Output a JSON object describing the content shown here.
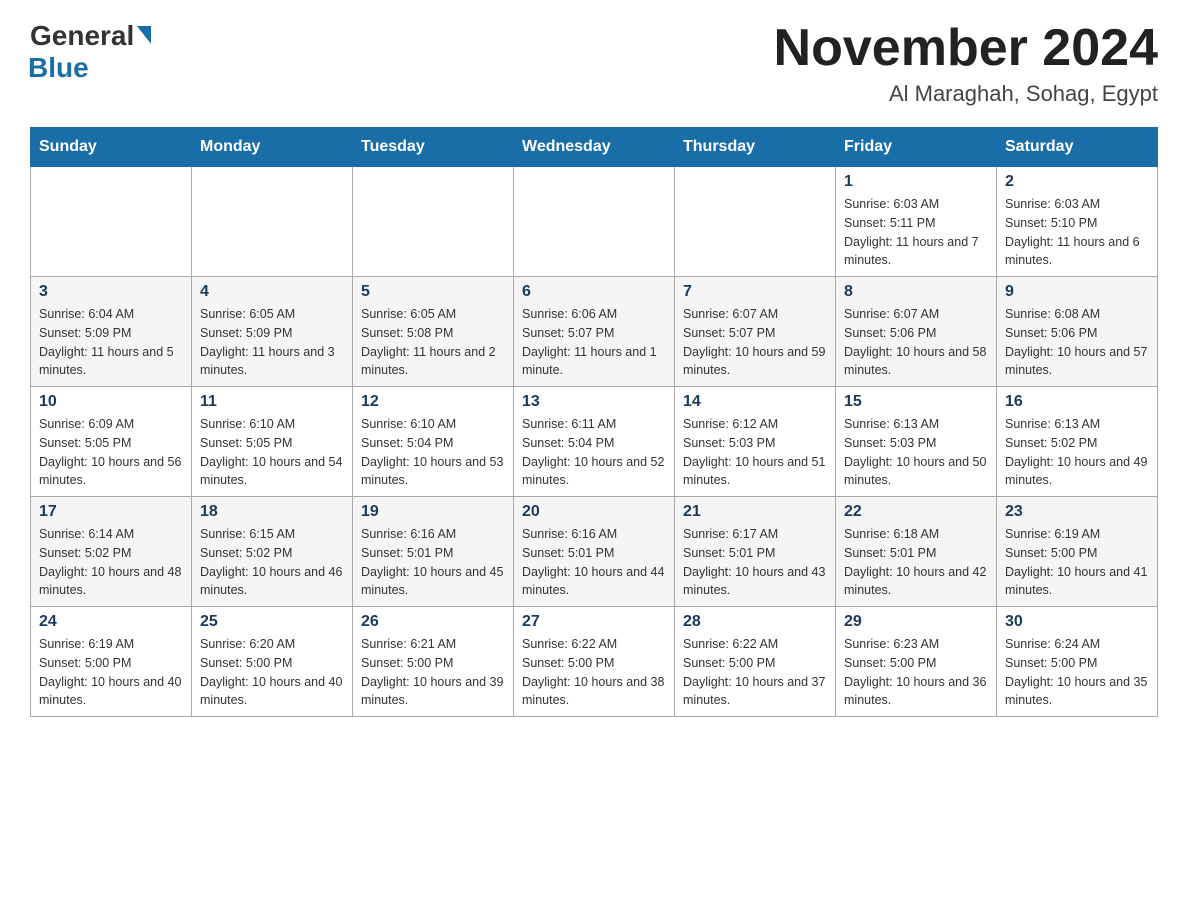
{
  "logo": {
    "general": "General",
    "blue": "Blue"
  },
  "title": "November 2024",
  "subtitle": "Al Maraghah, Sohag, Egypt",
  "headers": [
    "Sunday",
    "Monday",
    "Tuesday",
    "Wednesday",
    "Thursday",
    "Friday",
    "Saturday"
  ],
  "rows": [
    [
      {
        "day": "",
        "info": ""
      },
      {
        "day": "",
        "info": ""
      },
      {
        "day": "",
        "info": ""
      },
      {
        "day": "",
        "info": ""
      },
      {
        "day": "",
        "info": ""
      },
      {
        "day": "1",
        "info": "Sunrise: 6:03 AM\nSunset: 5:11 PM\nDaylight: 11 hours and 7 minutes."
      },
      {
        "day": "2",
        "info": "Sunrise: 6:03 AM\nSunset: 5:10 PM\nDaylight: 11 hours and 6 minutes."
      }
    ],
    [
      {
        "day": "3",
        "info": "Sunrise: 6:04 AM\nSunset: 5:09 PM\nDaylight: 11 hours and 5 minutes."
      },
      {
        "day": "4",
        "info": "Sunrise: 6:05 AM\nSunset: 5:09 PM\nDaylight: 11 hours and 3 minutes."
      },
      {
        "day": "5",
        "info": "Sunrise: 6:05 AM\nSunset: 5:08 PM\nDaylight: 11 hours and 2 minutes."
      },
      {
        "day": "6",
        "info": "Sunrise: 6:06 AM\nSunset: 5:07 PM\nDaylight: 11 hours and 1 minute."
      },
      {
        "day": "7",
        "info": "Sunrise: 6:07 AM\nSunset: 5:07 PM\nDaylight: 10 hours and 59 minutes."
      },
      {
        "day": "8",
        "info": "Sunrise: 6:07 AM\nSunset: 5:06 PM\nDaylight: 10 hours and 58 minutes."
      },
      {
        "day": "9",
        "info": "Sunrise: 6:08 AM\nSunset: 5:06 PM\nDaylight: 10 hours and 57 minutes."
      }
    ],
    [
      {
        "day": "10",
        "info": "Sunrise: 6:09 AM\nSunset: 5:05 PM\nDaylight: 10 hours and 56 minutes."
      },
      {
        "day": "11",
        "info": "Sunrise: 6:10 AM\nSunset: 5:05 PM\nDaylight: 10 hours and 54 minutes."
      },
      {
        "day": "12",
        "info": "Sunrise: 6:10 AM\nSunset: 5:04 PM\nDaylight: 10 hours and 53 minutes."
      },
      {
        "day": "13",
        "info": "Sunrise: 6:11 AM\nSunset: 5:04 PM\nDaylight: 10 hours and 52 minutes."
      },
      {
        "day": "14",
        "info": "Sunrise: 6:12 AM\nSunset: 5:03 PM\nDaylight: 10 hours and 51 minutes."
      },
      {
        "day": "15",
        "info": "Sunrise: 6:13 AM\nSunset: 5:03 PM\nDaylight: 10 hours and 50 minutes."
      },
      {
        "day": "16",
        "info": "Sunrise: 6:13 AM\nSunset: 5:02 PM\nDaylight: 10 hours and 49 minutes."
      }
    ],
    [
      {
        "day": "17",
        "info": "Sunrise: 6:14 AM\nSunset: 5:02 PM\nDaylight: 10 hours and 48 minutes."
      },
      {
        "day": "18",
        "info": "Sunrise: 6:15 AM\nSunset: 5:02 PM\nDaylight: 10 hours and 46 minutes."
      },
      {
        "day": "19",
        "info": "Sunrise: 6:16 AM\nSunset: 5:01 PM\nDaylight: 10 hours and 45 minutes."
      },
      {
        "day": "20",
        "info": "Sunrise: 6:16 AM\nSunset: 5:01 PM\nDaylight: 10 hours and 44 minutes."
      },
      {
        "day": "21",
        "info": "Sunrise: 6:17 AM\nSunset: 5:01 PM\nDaylight: 10 hours and 43 minutes."
      },
      {
        "day": "22",
        "info": "Sunrise: 6:18 AM\nSunset: 5:01 PM\nDaylight: 10 hours and 42 minutes."
      },
      {
        "day": "23",
        "info": "Sunrise: 6:19 AM\nSunset: 5:00 PM\nDaylight: 10 hours and 41 minutes."
      }
    ],
    [
      {
        "day": "24",
        "info": "Sunrise: 6:19 AM\nSunset: 5:00 PM\nDaylight: 10 hours and 40 minutes."
      },
      {
        "day": "25",
        "info": "Sunrise: 6:20 AM\nSunset: 5:00 PM\nDaylight: 10 hours and 40 minutes."
      },
      {
        "day": "26",
        "info": "Sunrise: 6:21 AM\nSunset: 5:00 PM\nDaylight: 10 hours and 39 minutes."
      },
      {
        "day": "27",
        "info": "Sunrise: 6:22 AM\nSunset: 5:00 PM\nDaylight: 10 hours and 38 minutes."
      },
      {
        "day": "28",
        "info": "Sunrise: 6:22 AM\nSunset: 5:00 PM\nDaylight: 10 hours and 37 minutes."
      },
      {
        "day": "29",
        "info": "Sunrise: 6:23 AM\nSunset: 5:00 PM\nDaylight: 10 hours and 36 minutes."
      },
      {
        "day": "30",
        "info": "Sunrise: 6:24 AM\nSunset: 5:00 PM\nDaylight: 10 hours and 35 minutes."
      }
    ]
  ]
}
